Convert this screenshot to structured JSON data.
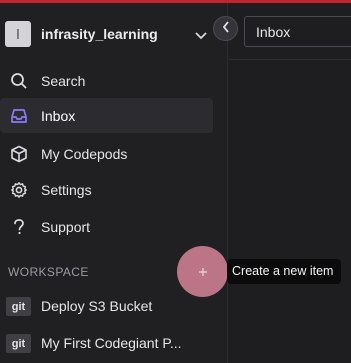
{
  "workspace": {
    "avatar_letter": "I",
    "name": "infrasity_learning"
  },
  "main": {
    "header_title": "Inbox"
  },
  "nav": {
    "items": [
      {
        "label": "Search",
        "icon": "search-icon"
      },
      {
        "label": "Inbox",
        "icon": "inbox-icon",
        "active": true
      },
      {
        "label": "My Codepods",
        "icon": "cube-icon"
      },
      {
        "label": "Settings",
        "icon": "gear-icon"
      },
      {
        "label": "Support",
        "icon": "question-icon"
      }
    ]
  },
  "workspace_section": {
    "label": "WORKSPACE",
    "pods": [
      {
        "badge": "git",
        "label": "Deploy S3 Bucket"
      },
      {
        "badge": "git",
        "label": "My First Codegiant P..."
      }
    ]
  },
  "create_button": {
    "tooltip": "Create a new item",
    "icon": "plus-icon"
  },
  "colors": {
    "accent_purple": "#8b7cf6",
    "top_bar_red": "#c0272d",
    "create_button_pink": "#c97d8f"
  }
}
